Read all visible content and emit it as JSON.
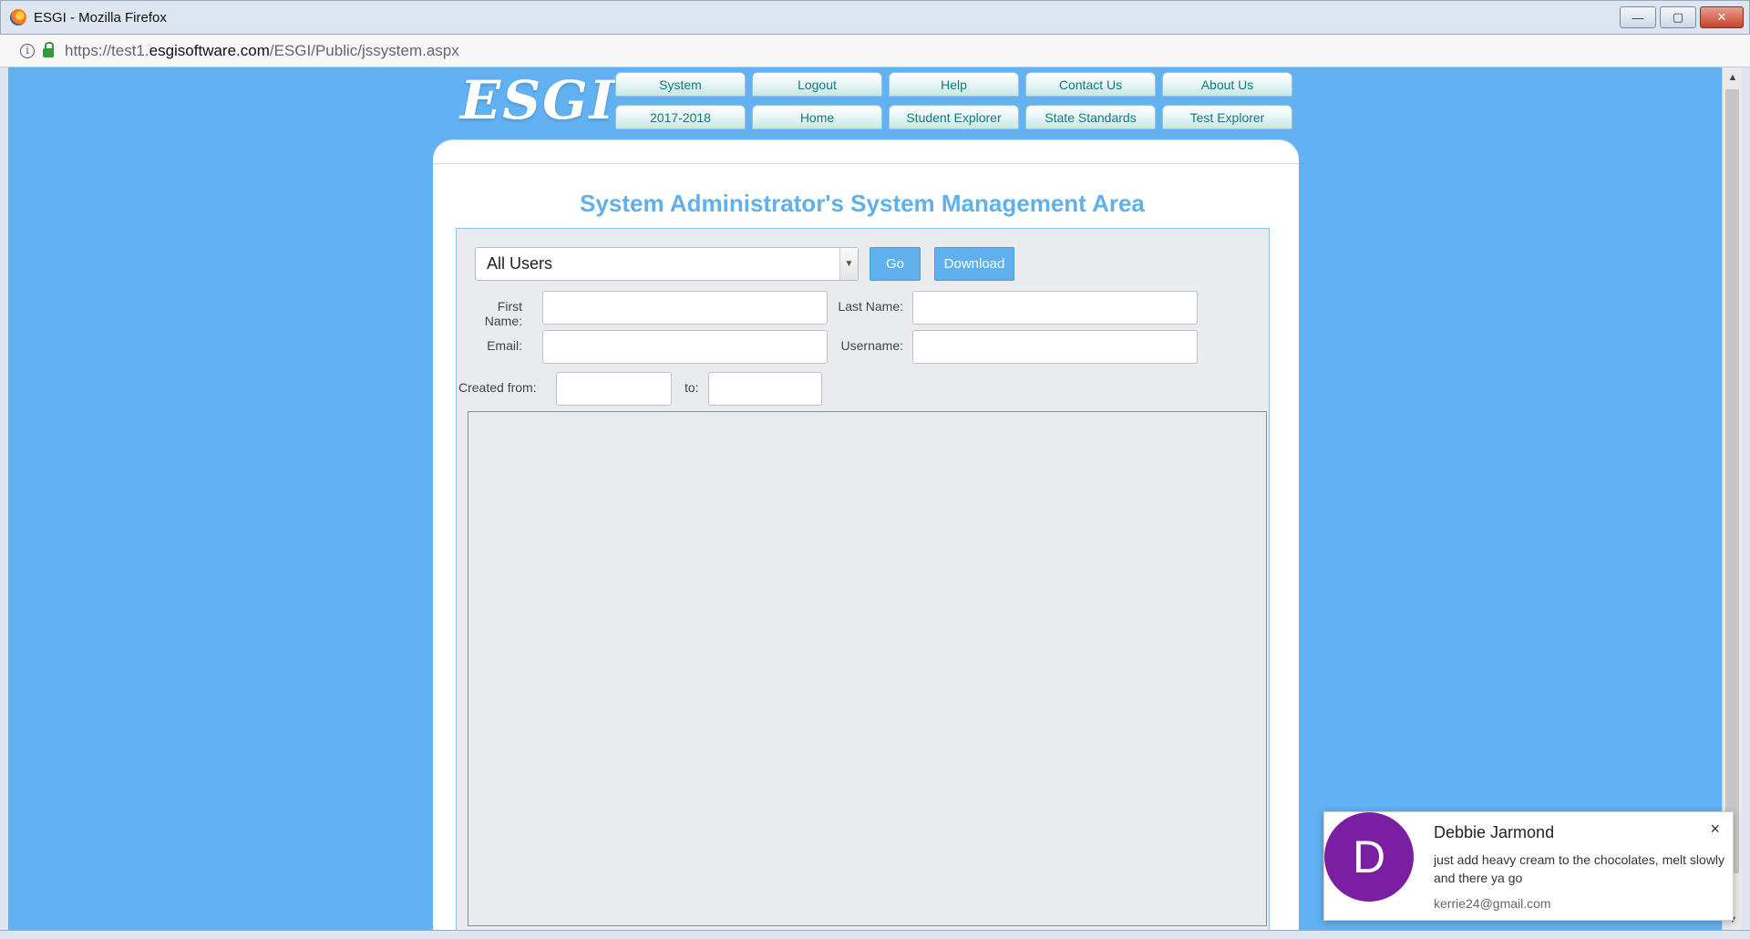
{
  "window": {
    "title": "ESGI - Mozilla Firefox",
    "controls": {
      "minimize": "—",
      "maximize": "▢",
      "close": "✕"
    }
  },
  "browser": {
    "url_prefix": "https://test1.",
    "url_domain": "esgisoftware.com",
    "url_path": "/ESGI/Public/jssystem.aspx"
  },
  "header": {
    "logo": "ESGI",
    "nav_row1": [
      "System",
      "Logout",
      "Help",
      "Contact Us",
      "About Us"
    ],
    "nav_row2": [
      "2017-2018",
      "Home",
      "Student Explorer",
      "State Standards",
      "Test Explorer"
    ]
  },
  "main": {
    "title": "System Administrator's System Management Area",
    "user_filter": {
      "selected": "All Users"
    },
    "go_label": "Go",
    "download_label": "Download",
    "first_name_label": "First Name:",
    "last_name_label": "Last Name:",
    "email_label": "Email:",
    "username_label": "Username:",
    "created_from_label": "Created from:",
    "to_label": "to:"
  },
  "notification": {
    "avatar_letter": "D",
    "sender": "Debbie Jarmond",
    "message": "just add heavy cream to the chocolates, melt slowly and there ya go",
    "email": "kerrie24@gmail.com",
    "close": "×"
  },
  "colors": {
    "page_background": "#62b1f2",
    "title_blue": "#5fb0ec",
    "nav_text": "#137a7c",
    "avatar": "#7b1fa2"
  }
}
